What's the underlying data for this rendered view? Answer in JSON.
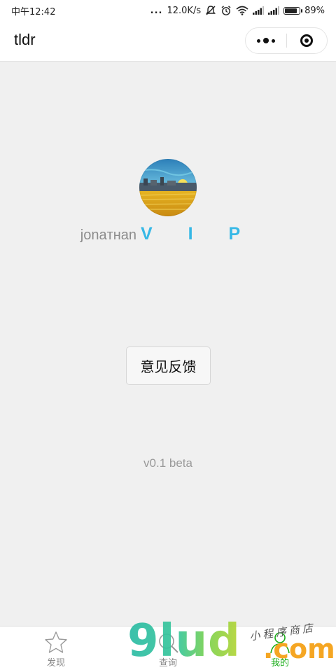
{
  "status_bar": {
    "time": "中午12:42",
    "dots": "...",
    "network_speed": "12.0K/s",
    "battery_percent": "89%",
    "battery_level": 0.89,
    "icons": [
      "dots-icon",
      "mute-icon",
      "alarm-icon",
      "wifi-icon",
      "signal-icon",
      "signal-icon",
      "battery-icon"
    ]
  },
  "nav_bar": {
    "title": "tldr",
    "more_icon": "more-dots-icon",
    "close_icon": "target-close-icon"
  },
  "profile": {
    "username": "jonaтнan",
    "vip_badge": "V I P",
    "vip_color": "#36b8e6"
  },
  "feedback_button": {
    "label": "意见反馈"
  },
  "version": "v0.1 beta",
  "tab_bar": {
    "tabs": [
      {
        "label": "发现",
        "icon": "star-icon"
      },
      {
        "label": "查询",
        "icon": "search-icon"
      },
      {
        "label": "我的",
        "icon": "user-icon"
      }
    ],
    "active_color": "#1aad19"
  },
  "watermark": {
    "brand": "9lud",
    "domain": ".com",
    "tagline": "小程序商店"
  }
}
